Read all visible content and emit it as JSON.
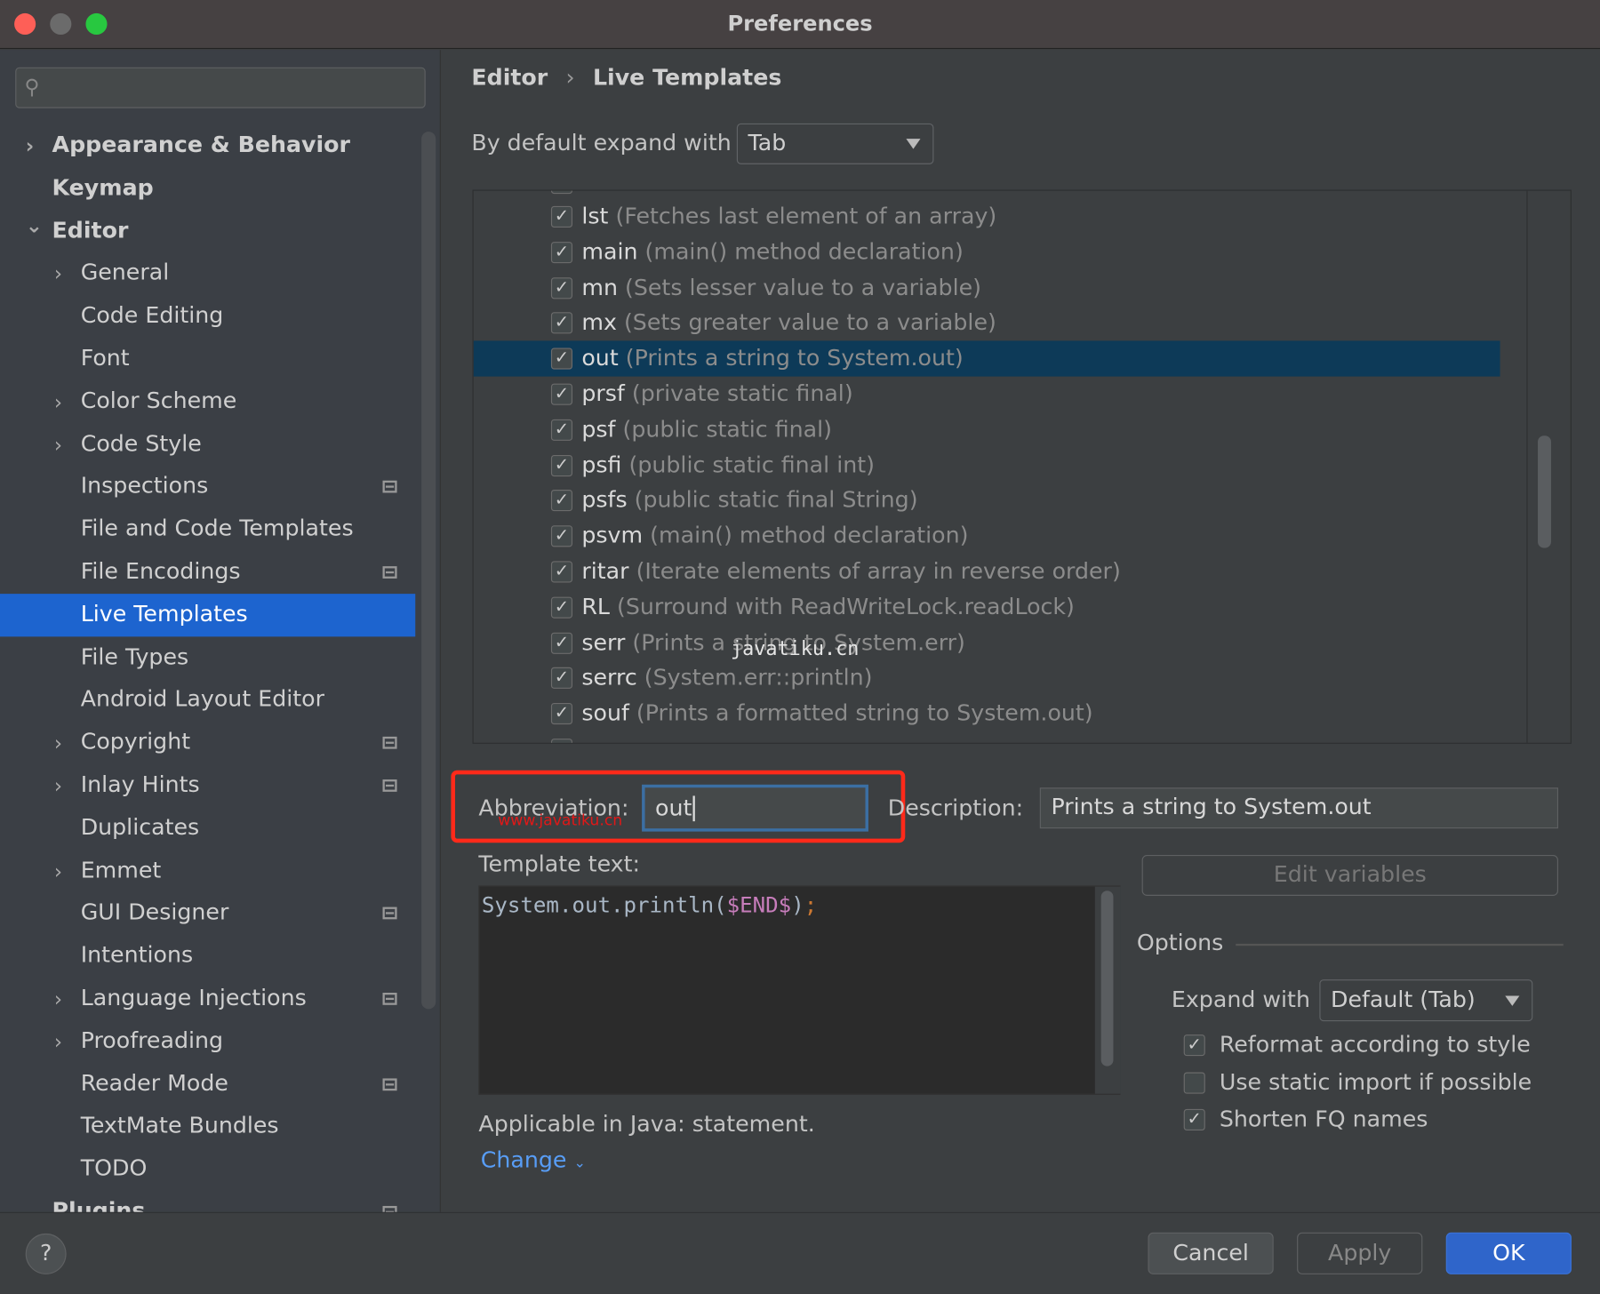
{
  "window": {
    "title": "Preferences",
    "controls": {
      "close": "#fe5f57",
      "minimize": "#6b6b6b",
      "zoom": "#28c840"
    }
  },
  "search": {
    "placeholder": "",
    "icon": "search-icon"
  },
  "sidebar": {
    "items": [
      {
        "label": "Appearance & Behavior",
        "level": 0,
        "expandable": true,
        "expanded": false,
        "bold": true
      },
      {
        "label": "Keymap",
        "level": 0,
        "bold": true
      },
      {
        "label": "Editor",
        "level": 0,
        "expandable": true,
        "expanded": true,
        "bold": true
      },
      {
        "label": "General",
        "level": 1,
        "expandable": true
      },
      {
        "label": "Code Editing",
        "level": 1
      },
      {
        "label": "Font",
        "level": 1
      },
      {
        "label": "Color Scheme",
        "level": 1,
        "expandable": true
      },
      {
        "label": "Code Style",
        "level": 1,
        "expandable": true
      },
      {
        "label": "Inspections",
        "level": 1,
        "badge": true
      },
      {
        "label": "File and Code Templates",
        "level": 1
      },
      {
        "label": "File Encodings",
        "level": 1,
        "badge": true
      },
      {
        "label": "Live Templates",
        "level": 1,
        "selected": true
      },
      {
        "label": "File Types",
        "level": 1
      },
      {
        "label": "Android Layout Editor",
        "level": 1
      },
      {
        "label": "Copyright",
        "level": 1,
        "expandable": true,
        "badge": true
      },
      {
        "label": "Inlay Hints",
        "level": 1,
        "expandable": true,
        "badge": true
      },
      {
        "label": "Duplicates",
        "level": 1
      },
      {
        "label": "Emmet",
        "level": 1,
        "expandable": true
      },
      {
        "label": "GUI Designer",
        "level": 1,
        "badge": true
      },
      {
        "label": "Intentions",
        "level": 1
      },
      {
        "label": "Language Injections",
        "level": 1,
        "expandable": true,
        "badge": true
      },
      {
        "label": "Proofreading",
        "level": 1,
        "expandable": true
      },
      {
        "label": "Reader Mode",
        "level": 1,
        "badge": true
      },
      {
        "label": "TextMate Bundles",
        "level": 1
      },
      {
        "label": "TODO",
        "level": 1
      },
      {
        "label": "Plugins",
        "level": 0,
        "bold": true,
        "badge": true
      }
    ]
  },
  "breadcrumb": {
    "parent": "Editor",
    "separator": "›",
    "current": "Live Templates"
  },
  "expand_default": {
    "label": "By default expand with",
    "value": "Tab"
  },
  "templates": [
    {
      "abbr": "",
      "desc": "",
      "checked": true,
      "partial": "top"
    },
    {
      "abbr": "lst",
      "desc": "(Fetches last element of an array)",
      "checked": true
    },
    {
      "abbr": "main",
      "desc": "(main() method declaration)",
      "checked": true
    },
    {
      "abbr": "mn",
      "desc": "(Sets lesser value to a variable)",
      "checked": true
    },
    {
      "abbr": "mx",
      "desc": "(Sets greater value to a variable)",
      "checked": true
    },
    {
      "abbr": "out",
      "desc": "(Prints a string to System.out)",
      "checked": true,
      "selected": true
    },
    {
      "abbr": "prsf",
      "desc": "(private static final)",
      "checked": true
    },
    {
      "abbr": "psf",
      "desc": "(public static final)",
      "checked": true
    },
    {
      "abbr": "psfi",
      "desc": "(public static final int)",
      "checked": true
    },
    {
      "abbr": "psfs",
      "desc": "(public static final String)",
      "checked": true
    },
    {
      "abbr": "psvm",
      "desc": "(main() method declaration)",
      "checked": true
    },
    {
      "abbr": "ritar",
      "desc": "(Iterate elements of array in reverse order)",
      "checked": true
    },
    {
      "abbr": "RL",
      "desc": "(Surround with ReadWriteLock.readLock)",
      "checked": true
    },
    {
      "abbr": "serr",
      "desc": "(Prints a string to System.err)",
      "checked": true
    },
    {
      "abbr": "serrc",
      "desc": "(System.err::println)",
      "checked": true
    },
    {
      "abbr": "souf",
      "desc": "(Prints a formatted string to System.out)",
      "checked": true
    },
    {
      "abbr": "",
      "desc": "",
      "checked": true,
      "partial": "bottom"
    }
  ],
  "list_tools": [
    {
      "icon": "plus-icon",
      "glyph": "+"
    },
    {
      "icon": "minus-icon",
      "glyph": "−"
    },
    {
      "icon": "copy-icon",
      "glyph": "⧉"
    },
    {
      "icon": "undo-icon",
      "glyph": "↶"
    }
  ],
  "watermark": {
    "center": "javatiku.cn",
    "red": "www.javatiku.cn"
  },
  "editor": {
    "abbreviation_label": "Abbreviation:",
    "abbreviation_value": "out",
    "description_label": "Description:",
    "description_value": "Prints a string to System.out",
    "template_label": "Template text:",
    "template_code": {
      "prefix": "System.out.println(",
      "variable": "$END$",
      "close": ")",
      "semicolon": ";"
    },
    "edit_variables": "Edit variables",
    "applicable": "Applicable in Java: statement.",
    "change": "Change"
  },
  "options": {
    "title": "Options",
    "expand_label": "Expand with",
    "expand_value": "Default (Tab)",
    "checks": [
      {
        "label": "Reformat according to style",
        "checked": true
      },
      {
        "label": "Use static import if possible",
        "checked": false
      },
      {
        "label": "Shorten FQ names",
        "checked": true
      }
    ]
  },
  "buttons": {
    "help": "?",
    "cancel": "Cancel",
    "apply": "Apply",
    "ok": "OK"
  },
  "colors": {
    "accent": "#1d64cf",
    "selection_row": "#0d3a58",
    "highlight_box": "#ff2a1a",
    "link": "#589df6",
    "variable": "#c77dbb",
    "semicolon": "#cc7832"
  }
}
